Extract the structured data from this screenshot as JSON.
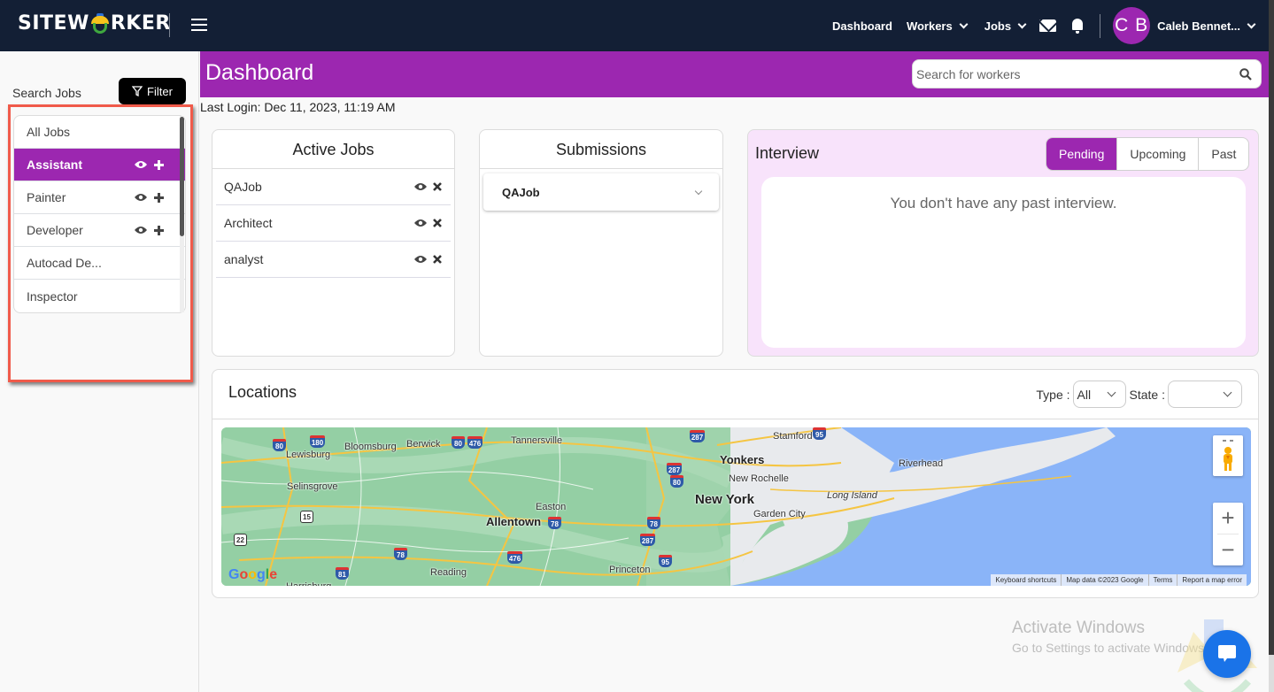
{
  "app": {
    "logo_text_left": "SITEW",
    "logo_text_right": "RKER",
    "accent_color": "#9c27b0",
    "nav_bg_color": "#131f35"
  },
  "topnav": {
    "links": [
      {
        "label": "Dashboard",
        "has_dropdown": false
      },
      {
        "label": "Workers",
        "has_dropdown": true
      },
      {
        "label": "Jobs",
        "has_dropdown": true
      }
    ],
    "icons": [
      "mail-icon",
      "bell-icon"
    ],
    "user": {
      "initials": "C B",
      "name": "Caleb Bennet..."
    }
  },
  "sidebar": {
    "search_label": "Search Jobs",
    "filter_label": "Filter",
    "jobs": [
      {
        "label": "All Jobs",
        "active": false,
        "actions": false
      },
      {
        "label": "Assistant",
        "active": true,
        "actions": true
      },
      {
        "label": "Painter",
        "active": false,
        "actions": true
      },
      {
        "label": "Developer",
        "active": false,
        "actions": true
      },
      {
        "label": "Autocad De...",
        "active": false,
        "actions": false
      },
      {
        "label": "Inspector",
        "active": false,
        "actions": false
      }
    ]
  },
  "header": {
    "title": "Dashboard",
    "search_placeholder": "Search for workers",
    "last_login": "Last Login: Dec 11, 2023, 11:19 AM"
  },
  "active_jobs": {
    "title": "Active Jobs",
    "items": [
      "QAJob",
      "Architect",
      "analyst"
    ]
  },
  "submissions": {
    "title": "Submissions",
    "items": [
      "QAJob"
    ]
  },
  "interview": {
    "title": "Interview",
    "tabs": [
      {
        "label": "Pending",
        "active": true
      },
      {
        "label": "Upcoming",
        "active": false
      },
      {
        "label": "Past",
        "active": false
      }
    ],
    "empty_message": "You don't have any past interview."
  },
  "locations": {
    "title": "Locations",
    "type_label": "Type :",
    "type_value": "All",
    "state_label": "State :",
    "state_value": "",
    "map": {
      "places": [
        "Lewisburg",
        "Bloomsburg",
        "Berwick",
        "Tannersville",
        "Selinsgrove",
        "Easton",
        "Allentown",
        "Reading",
        "Princeton",
        "Harrisburg",
        "Yonkers",
        "New Rochelle",
        "New York",
        "Stamford",
        "Garden City",
        "Long Island",
        "Riverhead"
      ],
      "highways": [
        "80",
        "180",
        "476",
        "80",
        "287",
        "287",
        "80",
        "15",
        "22",
        "78",
        "78",
        "78",
        "287",
        "95",
        "81",
        "476",
        "95",
        "287"
      ],
      "google_logo": "Google",
      "footer": [
        "Keyboard shortcuts",
        "Map data ©2023 Google",
        "Terms",
        "Report a map error"
      ],
      "zoom_in": "+",
      "zoom_out": "−"
    }
  },
  "watermark": {
    "line1": "Activate Windows",
    "line2": "Go to Settings to activate Windows."
  }
}
